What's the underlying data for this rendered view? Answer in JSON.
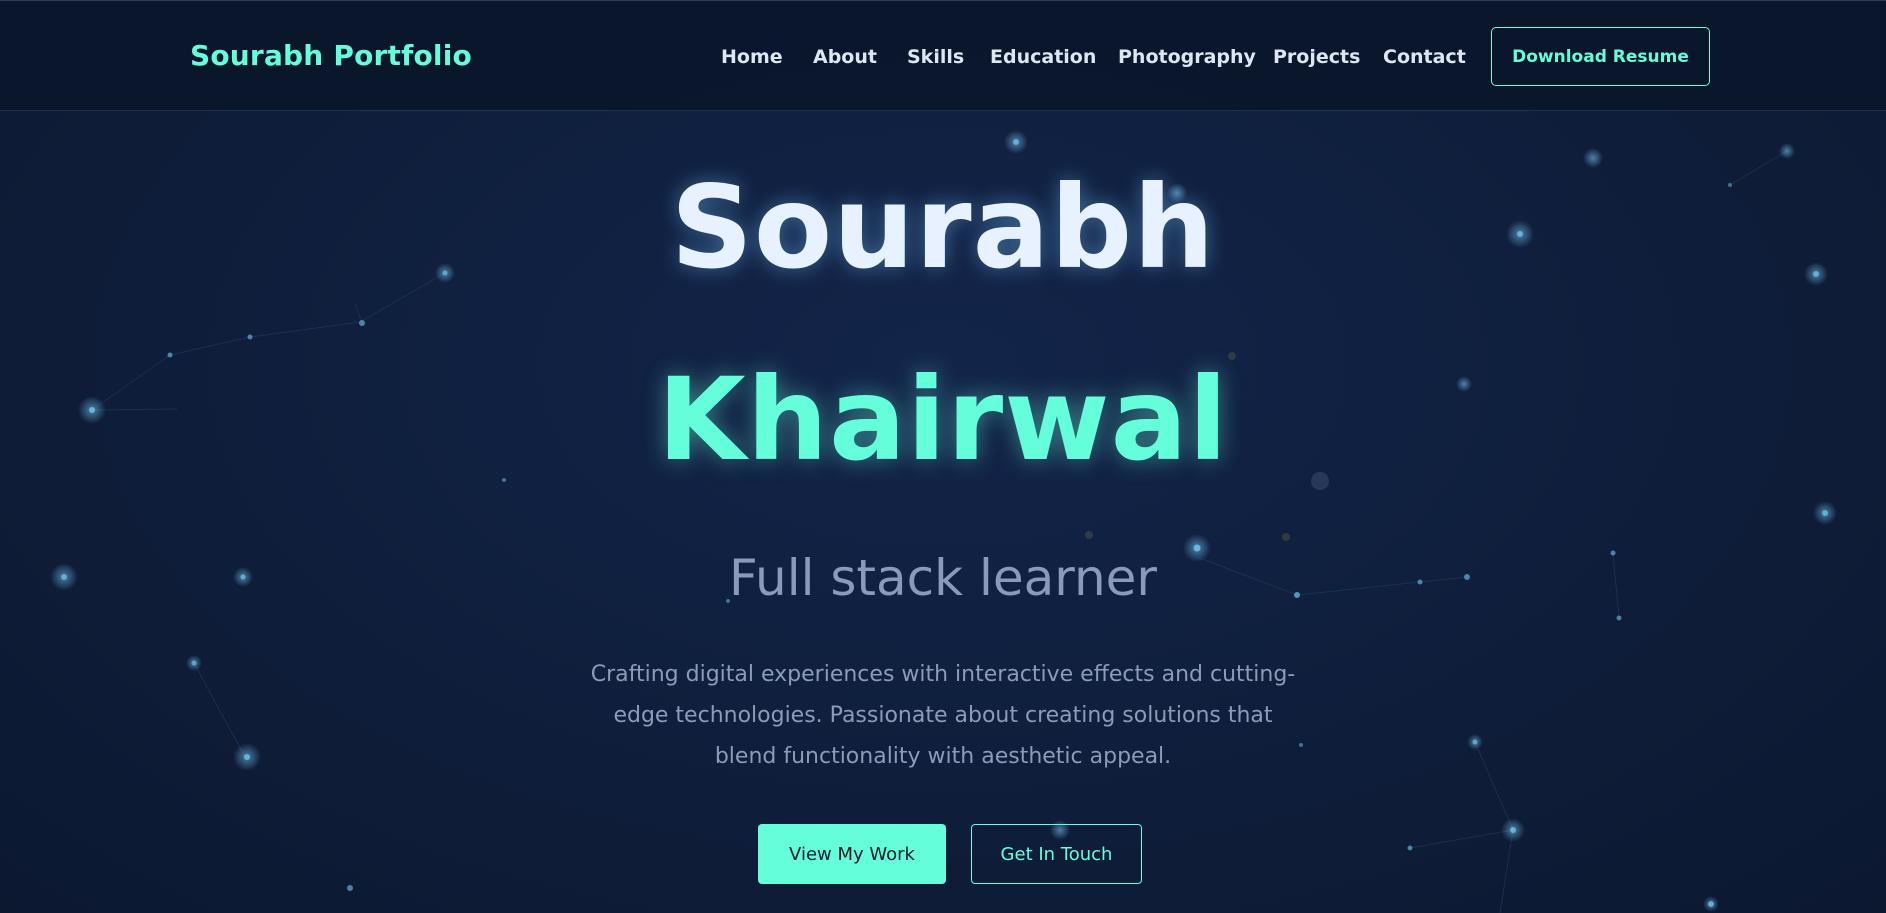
{
  "navbar": {
    "brand": "Sourabh Portfolio",
    "links": [
      {
        "label": "Home"
      },
      {
        "label": "About"
      },
      {
        "label": "Skills"
      },
      {
        "label": "Education"
      },
      {
        "label": "Photography"
      },
      {
        "label": "Projects"
      },
      {
        "label": "Contact"
      }
    ],
    "resume_button": "Download Resume"
  },
  "hero": {
    "first_name": "Sourabh",
    "last_name": "Khairwal",
    "subtitle": "Full stack learner",
    "description": "Crafting digital experiences with interactive effects and cutting-edge technologies. Passionate about creating solutions that blend functionality with aesthetic appeal.",
    "primary_button": "View My Work",
    "secondary_button": "Get In Touch"
  },
  "colors": {
    "accent": "#64ffda",
    "background": "#0f1f3d",
    "heading": "#e8f1ff",
    "muted_text": "#8a9bba"
  }
}
